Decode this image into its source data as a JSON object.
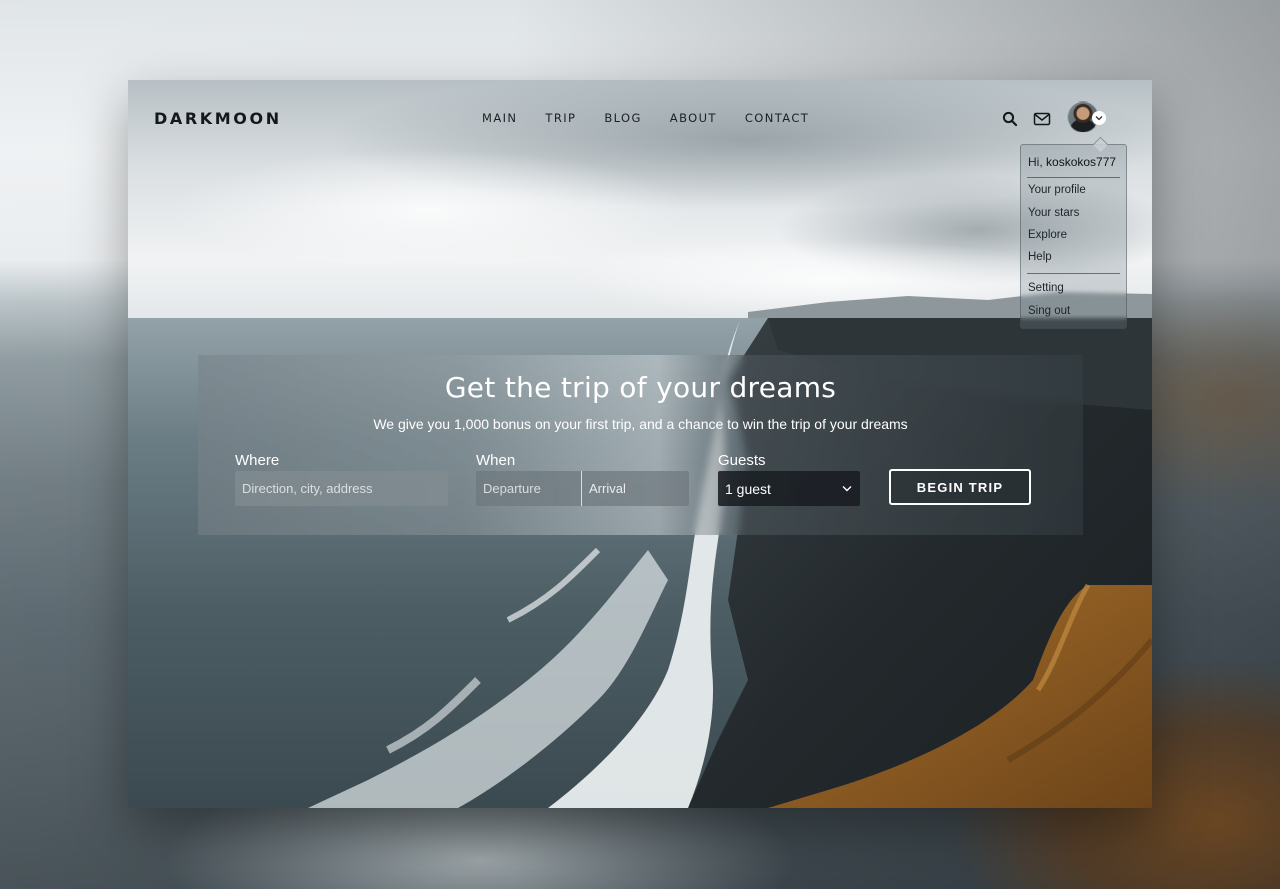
{
  "brand": {
    "logo": "DARKMOON"
  },
  "nav": {
    "items": [
      "MAIN",
      "TRIP",
      "BLOG",
      "ABOUT",
      "CONTACT"
    ]
  },
  "header_icons": [
    "search-icon",
    "mail-icon",
    "avatar",
    "chevron-down-icon"
  ],
  "user_menu": {
    "greeting_prefix": "Hi,",
    "username": "koskokos777",
    "items": [
      "Your profile",
      "Your stars",
      "Explore",
      "Help"
    ],
    "secondary_items": [
      "Setting",
      "Sing out"
    ]
  },
  "hero": {
    "title": "Get the trip of your dreams",
    "subtitle": "We give you 1,000 bonus on your first trip, and a chance to win the trip of your dreams"
  },
  "search_form": {
    "where": {
      "label": "Where",
      "placeholder": "Direction, city, address"
    },
    "when": {
      "label": "When",
      "departure": "Departure",
      "arrival": "Arrival"
    },
    "guests": {
      "label": "Guests",
      "value": "1 guest"
    },
    "submit_label": "BEGIN TRIP"
  },
  "colors": {
    "text_dark": "#15181b",
    "white": "#ffffff",
    "sand": "#9a6a2f",
    "sea": "#4a5a60"
  }
}
